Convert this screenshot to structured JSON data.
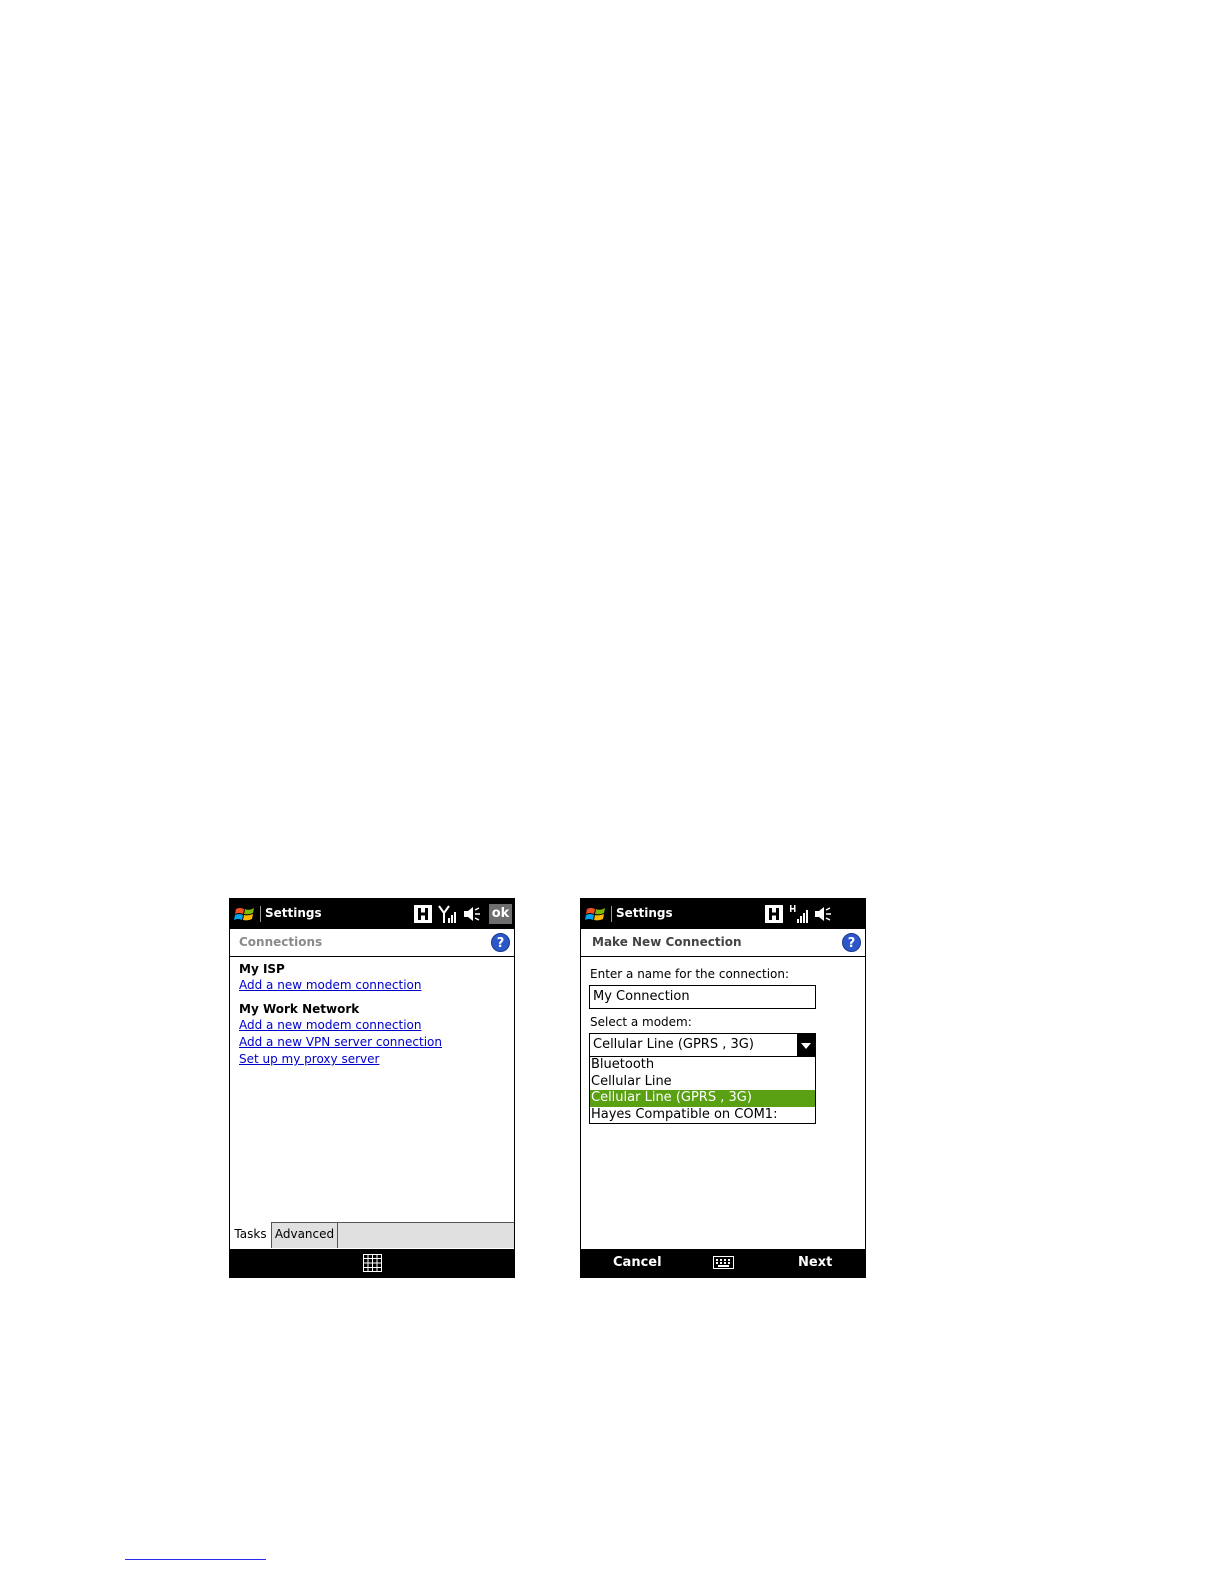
{
  "left": {
    "app_title": "Settings",
    "ok_label": "ok",
    "header_title": "Connections",
    "groups": [
      {
        "title": "My ISP",
        "links": [
          "Add a new modem connection"
        ]
      },
      {
        "title": "My Work Network",
        "links": [
          "Add a new modem connection",
          "Add a new VPN server connection",
          "Set up my proxy server"
        ]
      }
    ],
    "tabs": [
      "Tasks",
      "Advanced"
    ],
    "active_tab": "Tasks"
  },
  "right": {
    "app_title": "Settings",
    "header_title": "Make New Connection",
    "name_label": "Enter a name for the connection:",
    "name_value": "My Connection",
    "modem_label": "Select a modem:",
    "modem_selected": "Cellular Line (GPRS , 3G)",
    "modem_options": [
      "Bluetooth",
      "Cellular Line",
      "Cellular Line (GPRS , 3G)",
      "Hayes Compatible on COM1:"
    ],
    "highlighted_option_index": 2,
    "softkey_left": "Cancel",
    "softkey_right": "Next"
  },
  "colors": {
    "link": "#0000cc",
    "highlight": "#5aa013",
    "help_icon": "#2b57c8"
  }
}
